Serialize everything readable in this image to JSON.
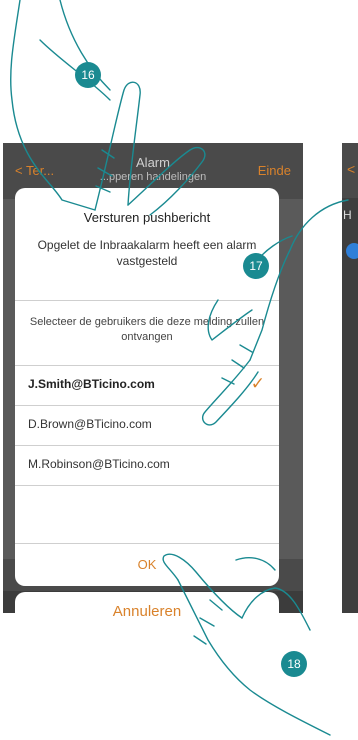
{
  "screen1": {
    "header": {
      "back_label": "< Ter...",
      "title": "Alarm",
      "subtitle": "...pperen handelingen",
      "done_label": "Einde"
    }
  },
  "screen2": {
    "back_label": "<",
    "row_letter": "H"
  },
  "dialog": {
    "title": "Versturen pushbericht",
    "message": "Opgelet de Inbraakalarm heeft een alarm vastgesteld",
    "select_prompt": "Selecteer de gebruikers die deze melding zullen ontvangen",
    "users": [
      {
        "email": "J.Smith@BTicino.com",
        "selected": true
      },
      {
        "email": "D.Brown@BTicino.com",
        "selected": false
      },
      {
        "email": "M.Robinson@BTicino.com",
        "selected": false
      }
    ],
    "check_icon": "✓",
    "ok_label": "OK"
  },
  "cancel_label": "Annuleren",
  "steps": [
    "16",
    "17",
    "18"
  ],
  "colors": {
    "accent": "#d9822b",
    "badge": "#1a8a91",
    "overlay": "#4a4a4a"
  }
}
